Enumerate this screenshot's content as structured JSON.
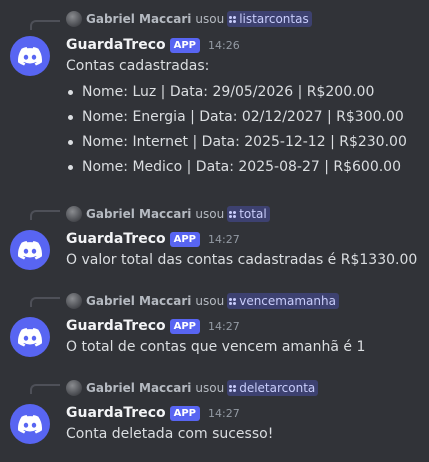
{
  "theme": {
    "background": "#313338",
    "blurple": "#5865f2",
    "text": "#dbdee1",
    "muted": "#949ba4",
    "command_bg": "rgba(88,101,242,0.30)"
  },
  "messages": [
    {
      "reply": {
        "user": "Gabriel Maccari",
        "verb": "usou",
        "command": "listarcontas"
      },
      "author": "GuardaTreco",
      "badge": "APP",
      "time": "14:26",
      "text": "Contas cadastradas:",
      "items": [
        "Nome: Luz | Data: 29/05/2026 | R$200.00",
        "Nome: Energia | Data: 02/12/2027 | R$300.00",
        "Nome: Internet | Data: 2025-12-12 | R$230.00",
        "Nome: Medico | Data: 2025-08-27 | R$600.00"
      ]
    },
    {
      "reply": {
        "user": "Gabriel Maccari",
        "verb": "usou",
        "command": "total"
      },
      "author": "GuardaTreco",
      "badge": "APP",
      "time": "14:27",
      "text": "O valor total das contas cadastradas é R$1330.00"
    },
    {
      "reply": {
        "user": "Gabriel Maccari",
        "verb": "usou",
        "command": "vencemamanha"
      },
      "author": "GuardaTreco",
      "badge": "APP",
      "time": "14:27",
      "text": "O total de contas que vencem amanhã é 1"
    },
    {
      "reply": {
        "user": "Gabriel Maccari",
        "verb": "usou",
        "command": "deletarconta"
      },
      "author": "GuardaTreco",
      "badge": "APP",
      "time": "14:27",
      "text": "Conta deletada com sucesso!"
    }
  ]
}
